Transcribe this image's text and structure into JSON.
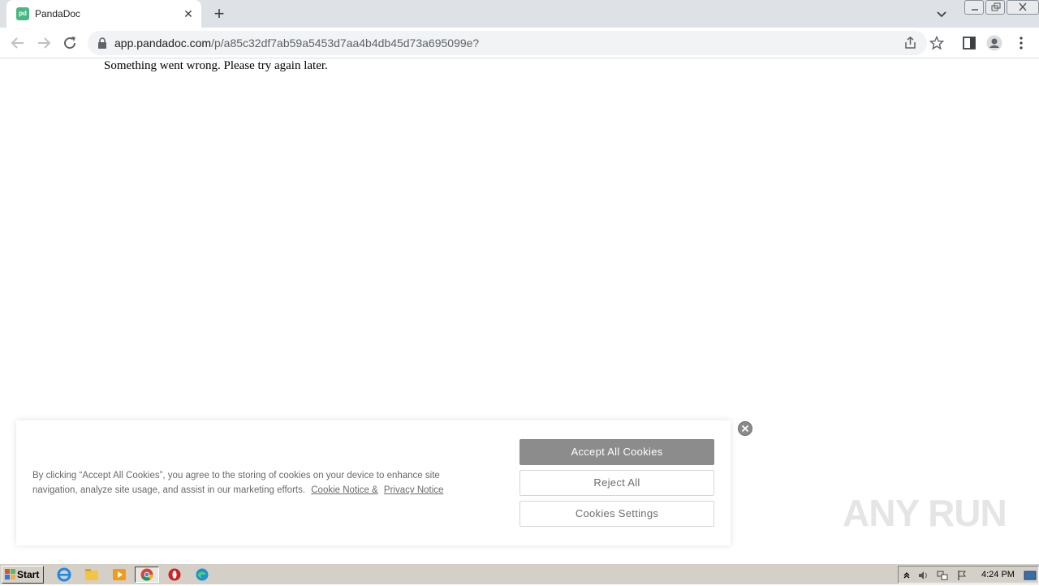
{
  "browser": {
    "tab": {
      "favicon_text": "pd",
      "title": "PandaDoc"
    },
    "url": {
      "host": "app.pandadoc.com",
      "path": "/p/a85c32df7ab59a5453d7aa4b4db45d73a695099e?"
    }
  },
  "page": {
    "message": "Something went wrong. Please try again later."
  },
  "cookie_banner": {
    "text": "By clicking “Accept All Cookies”, you agree to the storing of cookies on your device to enhance site navigation, analyze site usage, and assist in our marketing efforts.",
    "cookie_notice_link": "Cookie Notice &",
    "privacy_notice_link": "Privacy Notice",
    "accept_label": "Accept All Cookies",
    "reject_label": "Reject All",
    "settings_label": "Cookies Settings"
  },
  "watermark": {
    "text": "ANY RUN"
  },
  "taskbar": {
    "start_label": "Start",
    "clock": "4:24 PM"
  },
  "colors": {
    "pandadoc_green": "#47b881",
    "accept_button": "#8c8c8c",
    "taskbar": "#d4d0c8"
  }
}
